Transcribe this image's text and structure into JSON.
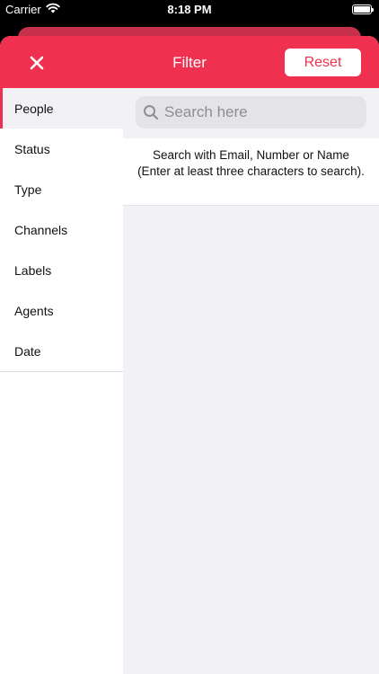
{
  "status_bar": {
    "carrier": "Carrier",
    "time": "8:18 PM"
  },
  "nav": {
    "title": "Filter",
    "reset_label": "Reset",
    "close_icon": "close-icon"
  },
  "menu": {
    "items": [
      {
        "label": "People",
        "active": true
      },
      {
        "label": "Status"
      },
      {
        "label": "Type"
      },
      {
        "label": "Channels"
      },
      {
        "label": "Labels"
      },
      {
        "label": "Agents"
      },
      {
        "label": "Date"
      }
    ]
  },
  "search": {
    "placeholder": "Search here",
    "value": ""
  },
  "hint": {
    "text": "Search with Email, Number or Name (Enter at least three characters to search)."
  },
  "colors": {
    "accent": "#f0304f",
    "background": "#f1f1f6"
  }
}
